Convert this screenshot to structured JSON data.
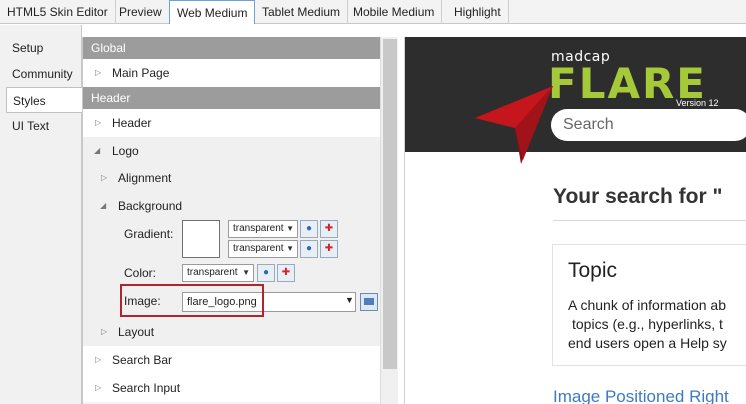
{
  "tabs": [
    {
      "label": "HTML5 Skin Editor"
    },
    {
      "label": "Preview"
    },
    {
      "label": "Web Medium"
    },
    {
      "label": "Tablet Medium"
    },
    {
      "label": "Mobile Medium"
    },
    {
      "label": "Highlight"
    }
  ],
  "side_tabs": [
    {
      "label": "Setup"
    },
    {
      "label": "Community"
    },
    {
      "label": "Styles"
    },
    {
      "label": "UI Text"
    }
  ],
  "props": {
    "global_header": "Global",
    "main_page": "Main Page",
    "header_header": "Header",
    "header_item": "Header",
    "logo": "Logo",
    "alignment": "Alignment",
    "background": "Background",
    "gradient_label": "Gradient:",
    "gradient_value_1": "transparent",
    "gradient_value_2": "transparent",
    "color_label": "Color:",
    "color_value": "transparent",
    "image_label": "Image:",
    "image_value": "flare_logo.png",
    "layout": "Layout",
    "search_bar": "Search Bar",
    "search_input": "Search Input"
  },
  "preview": {
    "madcap": "madcap",
    "flare": "FLARE",
    "version": "Version 12",
    "search_placeholder": "Search",
    "results_heading": "Your search for \"",
    "card_title": "Topic",
    "card_line_1": "A chunk of information ab",
    "card_line_2": "topics (e.g., hyperlinks, t",
    "card_line_3": "end users open a Help sy",
    "link_text": "Image Positioned Right"
  },
  "colors": {
    "section_header": "#9c9c9c",
    "flare_green": "#a6c939",
    "pointer_red": "#c4161c",
    "highlight_box": "#b1242b",
    "active_tab_border": "#6aa3d8"
  }
}
